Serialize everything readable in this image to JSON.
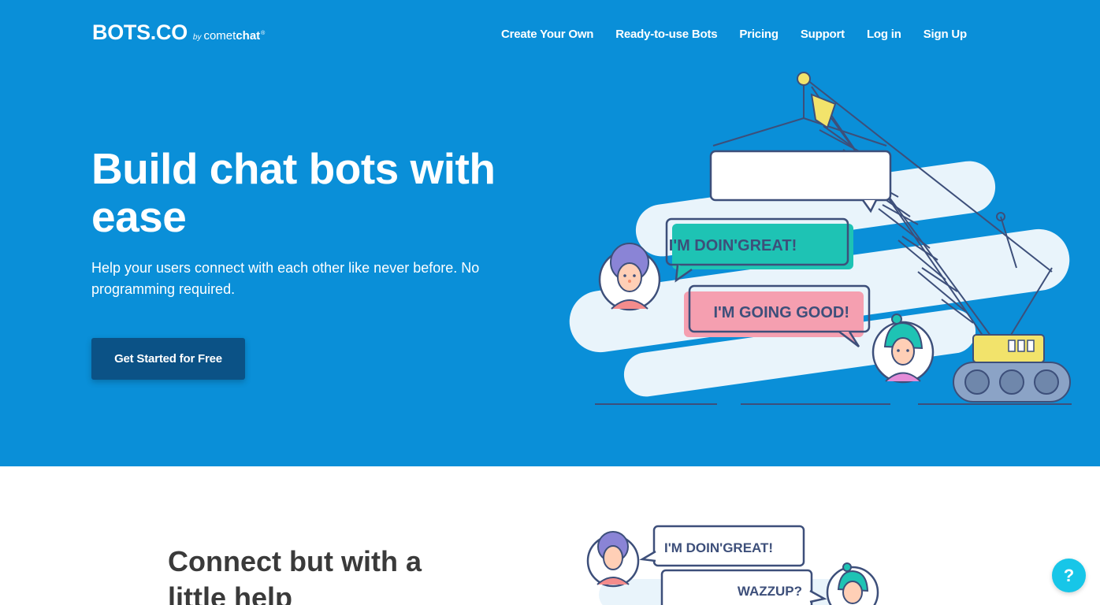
{
  "brand": {
    "name": "BOTS.CO",
    "by": "by",
    "partner_prefix": "comet",
    "partner_suffix": "chat",
    "registered": "®"
  },
  "nav": {
    "items": [
      {
        "label": "Create Your Own"
      },
      {
        "label": "Ready-to-use Bots"
      },
      {
        "label": "Pricing"
      },
      {
        "label": "Support"
      },
      {
        "label": "Log in"
      },
      {
        "label": "Sign Up"
      }
    ]
  },
  "hero": {
    "headline": "Build chat bots with ease",
    "subtext": "Help your users connect with each other like never before. No programming required.",
    "cta_label": "Get Started for Free",
    "illustration": {
      "bubble_1": "I'M DOIN'GREAT!",
      "bubble_2": "I'M GOING GOOD!"
    }
  },
  "section2": {
    "title": "Connect but with a little help",
    "illustration": {
      "bubble_1": "I'M DOIN'GREAT!",
      "bubble_2": "WAZZUP?"
    }
  },
  "help": {
    "label": "?"
  },
  "colors": {
    "hero_bg": "#0a8fd8",
    "cta_bg": "#0b5286",
    "bubble_teal": "#1ec3b4",
    "bubble_pink": "#f59fb0",
    "help_bg": "#17c6e8",
    "outline": "#3d4f7a"
  }
}
